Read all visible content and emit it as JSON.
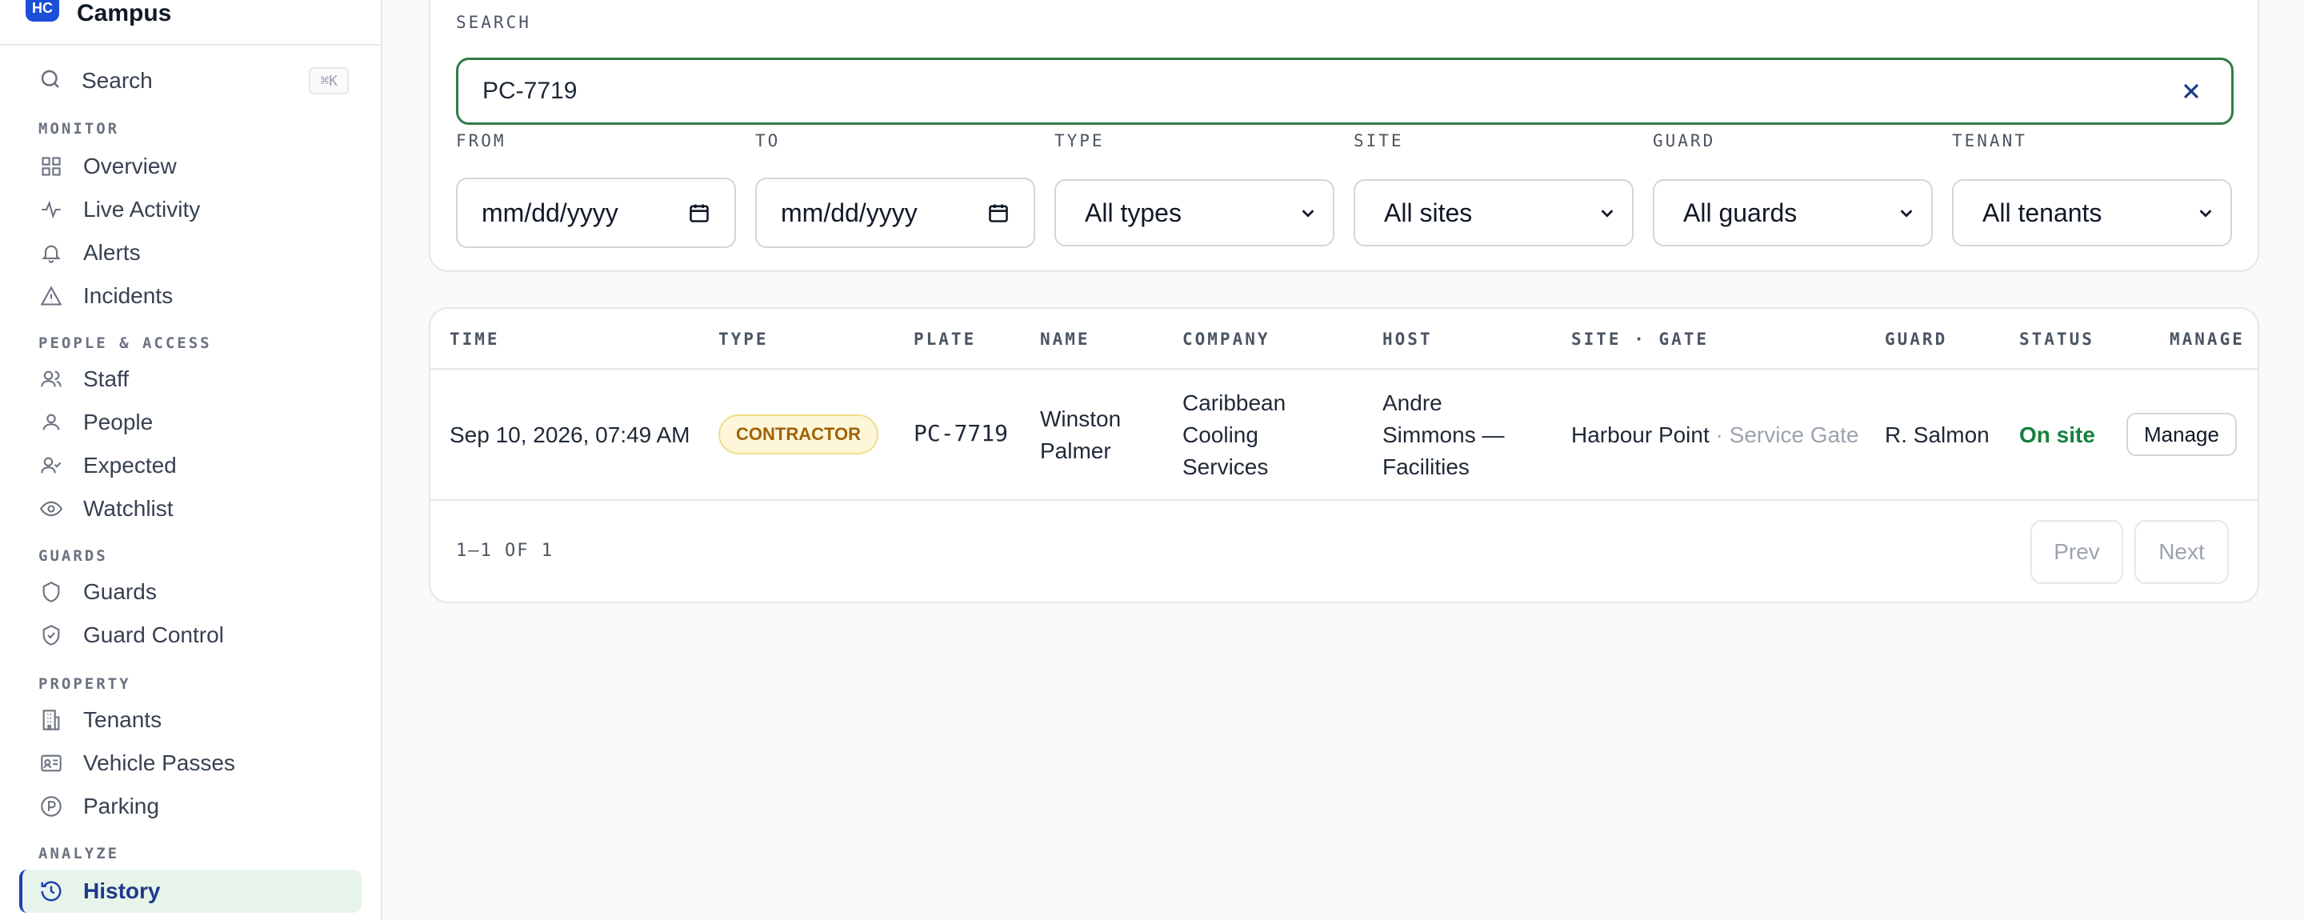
{
  "brand": {
    "logo_text": "HC",
    "name": "Campus"
  },
  "sidebar": {
    "search_label": "Search",
    "search_shortcut": "⌘K",
    "sections": {
      "monitor": "MONITOR",
      "people_access": "PEOPLE & ACCESS",
      "guards": "GUARDS",
      "property": "PROPERTY",
      "analyze": "ANALYZE"
    },
    "items": {
      "overview": "Overview",
      "live_activity": "Live Activity",
      "alerts": "Alerts",
      "incidents": "Incidents",
      "staff": "Staff",
      "people": "People",
      "expected": "Expected",
      "watchlist": "Watchlist",
      "guards": "Guards",
      "guard_control": "Guard Control",
      "tenants": "Tenants",
      "vehicle_passes": "Vehicle Passes",
      "parking": "Parking",
      "history": "History"
    }
  },
  "filters": {
    "search_label": "SEARCH",
    "search_value": "PC-7719",
    "from_label": "FROM",
    "from_placeholder": "mm/dd/yyyy",
    "to_label": "TO",
    "to_placeholder": "mm/dd/yyyy",
    "type_label": "TYPE",
    "type_value": "All types",
    "site_label": "SITE",
    "site_value": "All sites",
    "guard_label": "GUARD",
    "guard_value": "All guards",
    "tenant_label": "TENANT",
    "tenant_value": "All tenants"
  },
  "table": {
    "headers": {
      "time": "TIME",
      "type": "TYPE",
      "plate": "PLATE",
      "name": "NAME",
      "company": "COMPANY",
      "host": "HOST",
      "site_gate": "SITE · GATE",
      "guard": "GUARD",
      "status": "STATUS",
      "manage": "MANAGE"
    },
    "rows": [
      {
        "time": "Sep 10, 2026, 07:49 AM",
        "type": "CONTRACTOR",
        "plate": "PC-7719",
        "name_line1": "Winston",
        "name_line2": "Palmer",
        "company_line1": "Caribbean",
        "company_line2": "Cooling",
        "company_line3": "Services",
        "host_line1": "Andre",
        "host_line2": "Simmons —",
        "host_line3": "Facilities",
        "site": "Harbour Point",
        "gate": "· Service Gate",
        "guard": "R. Salmon",
        "status": "On site",
        "manage_label": "Manage"
      }
    ],
    "pager_count": "1–1 OF 1",
    "prev_label": "Prev",
    "next_label": "Next"
  },
  "colors": {
    "accent_green": "#2f7d4a",
    "active_bg": "#e7f4ea",
    "status_on": "#15803d",
    "badge_bg": "#fdf6d8",
    "badge_text": "#a16207"
  }
}
